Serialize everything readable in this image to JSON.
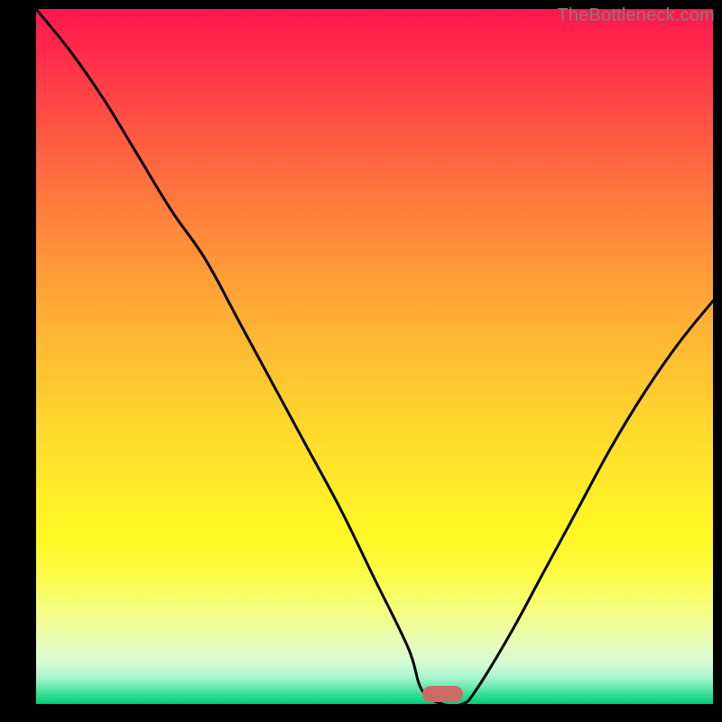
{
  "watermark": {
    "text": "TheBottleneck.com"
  },
  "palette": {
    "background": "#000000",
    "gradient_top": "#ff1750",
    "gradient_mid": "#ffe028",
    "gradient_bottom": "#00d077",
    "curve": "#000000",
    "marker": "#cc6b66",
    "watermark": "#7d7d7d"
  },
  "chart_data": {
    "type": "line",
    "title": "",
    "xlabel": "",
    "ylabel": "",
    "xlim": [
      0,
      100
    ],
    "ylim": [
      0,
      100
    ],
    "grid": false,
    "legend": false,
    "series": [
      {
        "name": "bottleneck-curve",
        "x": [
          0,
          5,
          10,
          15,
          20,
          25,
          30,
          35,
          40,
          45,
          50,
          55,
          57,
          60,
          63,
          65,
          70,
          75,
          80,
          85,
          90,
          95,
          100
        ],
        "y": [
          100,
          94,
          87,
          79,
          71,
          64,
          55,
          46,
          37,
          28,
          18,
          8,
          2,
          0,
          0,
          2,
          10,
          19,
          28,
          37,
          45,
          52,
          58
        ]
      }
    ],
    "marker": {
      "x_start": 57,
      "x_end": 63,
      "y": 0,
      "color": "#cc6b66"
    },
    "notes": "Values are approximate, read from an unlabeled gradient chart. y=0 corresponds to the green bottom edge; y=100 to the top edge."
  }
}
